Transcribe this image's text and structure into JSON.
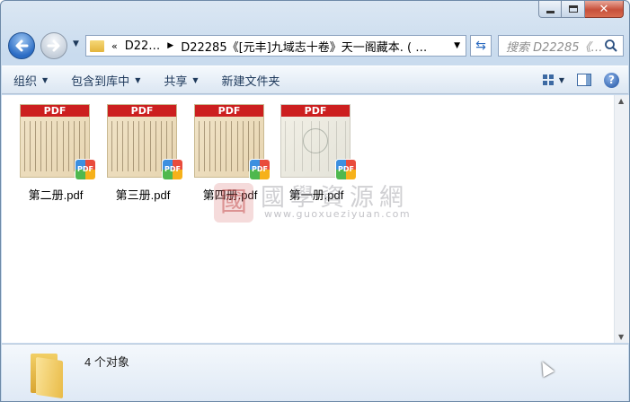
{
  "window": {
    "caption_buttons": {
      "minimize": "minimize",
      "maximize": "maximize",
      "close": "✕"
    }
  },
  "address": {
    "chevron": "«",
    "crumbs": [
      "D22…",
      "D22285《[元丰]九域志十卷》天一阁藏本. ( …"
    ],
    "dropdown_icon": "chevron-down-icon"
  },
  "search": {
    "placeholder": "搜索 D22285《…"
  },
  "toolbar": {
    "organize": "组织",
    "include_in_library": "包含到库中",
    "share": "共享",
    "new_folder": "新建文件夹"
  },
  "files": [
    {
      "name": "第二册.pdf",
      "thumb_label": "PDF",
      "badge": "PDF"
    },
    {
      "name": "第三册.pdf",
      "thumb_label": "PDF",
      "badge": "PDF"
    },
    {
      "name": "第四册.pdf",
      "thumb_label": "PDF",
      "badge": "PDF"
    },
    {
      "name": "第一册.pdf",
      "thumb_label": "PDF",
      "badge": "PDF"
    }
  ],
  "watermark": {
    "title": "國學資源網",
    "url": "www.guoxueziyuan.com"
  },
  "status": {
    "item_count": "4 个对象"
  },
  "colors": {
    "accent": "#2b6cc4",
    "pdf_red": "#cc1f1f",
    "toolbar_text": "#1e395b"
  }
}
